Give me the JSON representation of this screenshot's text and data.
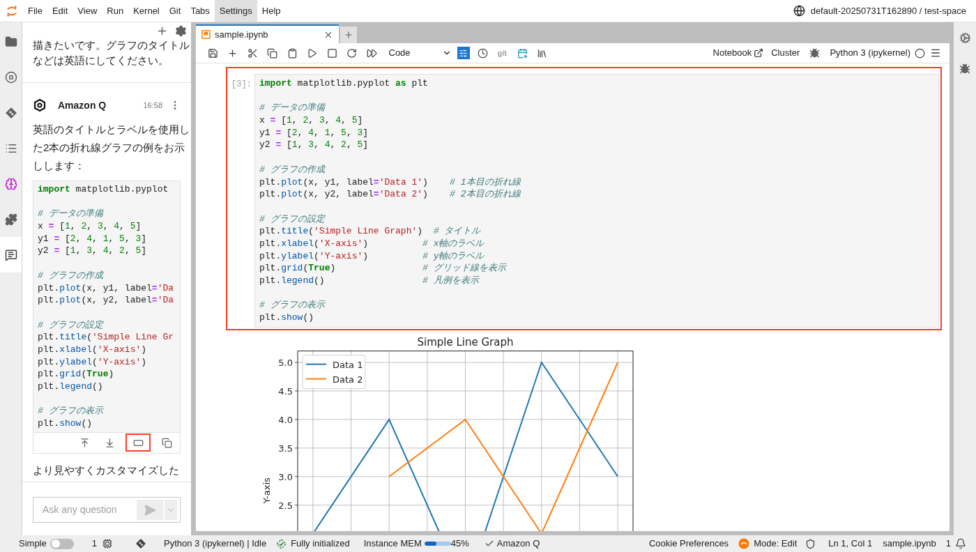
{
  "menu_bar": {
    "items": [
      {
        "label": "File",
        "selected": false
      },
      {
        "label": "Edit",
        "selected": false
      },
      {
        "label": "View",
        "selected": false
      },
      {
        "label": "Run",
        "selected": false
      },
      {
        "label": "Kernel",
        "selected": false
      },
      {
        "label": "Git",
        "selected": false
      },
      {
        "label": "Tabs",
        "selected": false
      },
      {
        "label": "Settings",
        "selected": true
      },
      {
        "label": "Help",
        "selected": false
      }
    ],
    "workspace": "default-20250731T162890 / test-space"
  },
  "activity_bar": {
    "items": [
      {
        "selected": false
      },
      {
        "selected": false
      },
      {
        "selected": false
      },
      {
        "selected": false
      },
      {
        "selected": false
      },
      {
        "selected": false
      },
      {
        "selected": true
      }
    ]
  },
  "chat": {
    "messages": [
      {
        "kind": "user",
        "text": "描きたいです。グラフのタイトルなどは英語にしてください。"
      },
      {
        "kind": "assistant",
        "sender": "Amazon Q",
        "time": "16:58",
        "text": "英語のタイトルとラベルを使用した2本の折れ線グラフの例をお示しします：",
        "code_lines": [
          {
            "kind": "code",
            "tokens": [
              {
                "kind": "kw",
                "text": "import"
              },
              {
                "kind": "plain",
                "text": " matplotlib.pyplot"
              }
            ]
          },
          {
            "kind": "blank"
          },
          {
            "kind": "code",
            "tokens": [
              {
                "kind": "cm",
                "text": "# データの準備"
              }
            ]
          },
          {
            "kind": "code",
            "tokens": [
              {
                "kind": "plain",
                "text": "x "
              },
              {
                "kind": "op",
                "text": "="
              },
              {
                "kind": "plain",
                "text": " ["
              },
              {
                "kind": "num",
                "text": "1"
              },
              {
                "kind": "plain",
                "text": ", "
              },
              {
                "kind": "num",
                "text": "2"
              },
              {
                "kind": "plain",
                "text": ", "
              },
              {
                "kind": "num",
                "text": "3"
              },
              {
                "kind": "plain",
                "text": ", "
              },
              {
                "kind": "num",
                "text": "4"
              },
              {
                "kind": "plain",
                "text": ", "
              },
              {
                "kind": "num",
                "text": "5"
              },
              {
                "kind": "plain",
                "text": "]"
              }
            ]
          },
          {
            "kind": "code",
            "tokens": [
              {
                "kind": "plain",
                "text": "y1 "
              },
              {
                "kind": "op",
                "text": "="
              },
              {
                "kind": "plain",
                "text": " ["
              },
              {
                "kind": "num",
                "text": "2"
              },
              {
                "kind": "plain",
                "text": ", "
              },
              {
                "kind": "num",
                "text": "4"
              },
              {
                "kind": "plain",
                "text": ", "
              },
              {
                "kind": "num",
                "text": "1"
              },
              {
                "kind": "plain",
                "text": ", "
              },
              {
                "kind": "num",
                "text": "5"
              },
              {
                "kind": "plain",
                "text": ", "
              },
              {
                "kind": "num",
                "text": "3"
              },
              {
                "kind": "plain",
                "text": "]"
              }
            ]
          },
          {
            "kind": "code",
            "tokens": [
              {
                "kind": "plain",
                "text": "y2 "
              },
              {
                "kind": "op",
                "text": "="
              },
              {
                "kind": "plain",
                "text": " ["
              },
              {
                "kind": "num",
                "text": "1"
              },
              {
                "kind": "plain",
                "text": ", "
              },
              {
                "kind": "num",
                "text": "3"
              },
              {
                "kind": "plain",
                "text": ", "
              },
              {
                "kind": "num",
                "text": "4"
              },
              {
                "kind": "plain",
                "text": ", "
              },
              {
                "kind": "num",
                "text": "2"
              },
              {
                "kind": "plain",
                "text": ", "
              },
              {
                "kind": "num",
                "text": "5"
              },
              {
                "kind": "plain",
                "text": "]"
              }
            ]
          },
          {
            "kind": "blank"
          },
          {
            "kind": "code",
            "tokens": [
              {
                "kind": "cm",
                "text": "# グラフの作成"
              }
            ]
          },
          {
            "kind": "code",
            "tokens": [
              {
                "kind": "plain",
                "text": "plt."
              },
              {
                "kind": "fn",
                "text": "plot"
              },
              {
                "kind": "plain",
                "text": "(x, y1, label"
              },
              {
                "kind": "op",
                "text": "="
              },
              {
                "kind": "str",
                "text": "'Da"
              }
            ]
          },
          {
            "kind": "code",
            "tokens": [
              {
                "kind": "plain",
                "text": "plt."
              },
              {
                "kind": "fn",
                "text": "plot"
              },
              {
                "kind": "plain",
                "text": "(x, y2, label"
              },
              {
                "kind": "op",
                "text": "="
              },
              {
                "kind": "str",
                "text": "'Da"
              }
            ]
          },
          {
            "kind": "blank"
          },
          {
            "kind": "code",
            "tokens": [
              {
                "kind": "cm",
                "text": "# グラフの設定"
              }
            ]
          },
          {
            "kind": "code",
            "tokens": [
              {
                "kind": "plain",
                "text": "plt."
              },
              {
                "kind": "fn",
                "text": "title"
              },
              {
                "kind": "plain",
                "text": "("
              },
              {
                "kind": "str",
                "text": "'Simple Line Gr"
              }
            ]
          },
          {
            "kind": "code",
            "tokens": [
              {
                "kind": "plain",
                "text": "plt."
              },
              {
                "kind": "fn",
                "text": "xlabel"
              },
              {
                "kind": "plain",
                "text": "("
              },
              {
                "kind": "str",
                "text": "'X-axis'"
              },
              {
                "kind": "plain",
                "text": ")"
              }
            ]
          },
          {
            "kind": "code",
            "tokens": [
              {
                "kind": "plain",
                "text": "plt."
              },
              {
                "kind": "fn",
                "text": "ylabel"
              },
              {
                "kind": "plain",
                "text": "("
              },
              {
                "kind": "str",
                "text": "'Y-axis'"
              },
              {
                "kind": "plain",
                "text": ")"
              }
            ]
          },
          {
            "kind": "code",
            "tokens": [
              {
                "kind": "plain",
                "text": "plt."
              },
              {
                "kind": "fn",
                "text": "grid"
              },
              {
                "kind": "plain",
                "text": "("
              },
              {
                "kind": "kw",
                "text": "True"
              },
              {
                "kind": "plain",
                "text": ")"
              }
            ]
          },
          {
            "kind": "code",
            "tokens": [
              {
                "kind": "plain",
                "text": "plt."
              },
              {
                "kind": "fn",
                "text": "legend"
              },
              {
                "kind": "plain",
                "text": "()"
              }
            ]
          },
          {
            "kind": "blank"
          },
          {
            "kind": "code",
            "tokens": [
              {
                "kind": "cm",
                "text": "# グラフの表示"
              }
            ]
          },
          {
            "kind": "code",
            "tokens": [
              {
                "kind": "plain",
                "text": "plt."
              },
              {
                "kind": "fn",
                "text": "show"
              },
              {
                "kind": "plain",
                "text": "()"
              }
            ]
          }
        ],
        "code_actions": [
          {
            "highlighted": false
          },
          {
            "highlighted": false
          },
          {
            "highlighted": true
          },
          {
            "highlighted": false
          }
        ],
        "continuation": "より見やすくカスタマイズした"
      }
    ],
    "input": {
      "placeholder": "Ask any question"
    }
  },
  "notebook": {
    "tabs": [
      {
        "label": "sample.ipynb",
        "selected": true
      }
    ],
    "toolbar": {
      "cell_type": "Code",
      "git_label": "git",
      "notebook_link": "Notebook",
      "cluster_link": "Cluster",
      "kernel": "Python 3 (ipykernel)"
    },
    "cell": {
      "prompt": "[3]:",
      "highlighted": true,
      "code_lines": [
        {
          "kind": "code",
          "tokens": [
            {
              "kind": "kw",
              "text": "import"
            },
            {
              "kind": "plain",
              "text": " matplotlib.pyplot "
            },
            {
              "kind": "kw",
              "text": "as"
            },
            {
              "kind": "plain",
              "text": " plt"
            }
          ]
        },
        {
          "kind": "blank"
        },
        {
          "kind": "code",
          "tokens": [
            {
              "kind": "cm",
              "text": "# データの準備"
            }
          ]
        },
        {
          "kind": "code",
          "tokens": [
            {
              "kind": "plain",
              "text": "x "
            },
            {
              "kind": "op",
              "text": "="
            },
            {
              "kind": "plain",
              "text": " ["
            },
            {
              "kind": "num",
              "text": "1"
            },
            {
              "kind": "plain",
              "text": ", "
            },
            {
              "kind": "num",
              "text": "2"
            },
            {
              "kind": "plain",
              "text": ", "
            },
            {
              "kind": "num",
              "text": "3"
            },
            {
              "kind": "plain",
              "text": ", "
            },
            {
              "kind": "num",
              "text": "4"
            },
            {
              "kind": "plain",
              "text": ", "
            },
            {
              "kind": "num",
              "text": "5"
            },
            {
              "kind": "plain",
              "text": "]"
            }
          ]
        },
        {
          "kind": "code",
          "tokens": [
            {
              "kind": "plain",
              "text": "y1 "
            },
            {
              "kind": "op",
              "text": "="
            },
            {
              "kind": "plain",
              "text": " ["
            },
            {
              "kind": "num",
              "text": "2"
            },
            {
              "kind": "plain",
              "text": ", "
            },
            {
              "kind": "num",
              "text": "4"
            },
            {
              "kind": "plain",
              "text": ", "
            },
            {
              "kind": "num",
              "text": "1"
            },
            {
              "kind": "plain",
              "text": ", "
            },
            {
              "kind": "num",
              "text": "5"
            },
            {
              "kind": "plain",
              "text": ", "
            },
            {
              "kind": "num",
              "text": "3"
            },
            {
              "kind": "plain",
              "text": "]"
            }
          ]
        },
        {
          "kind": "code",
          "tokens": [
            {
              "kind": "plain",
              "text": "y2 "
            },
            {
              "kind": "op",
              "text": "="
            },
            {
              "kind": "plain",
              "text": " ["
            },
            {
              "kind": "num",
              "text": "1"
            },
            {
              "kind": "plain",
              "text": ", "
            },
            {
              "kind": "num",
              "text": "3"
            },
            {
              "kind": "plain",
              "text": ", "
            },
            {
              "kind": "num",
              "text": "4"
            },
            {
              "kind": "plain",
              "text": ", "
            },
            {
              "kind": "num",
              "text": "2"
            },
            {
              "kind": "plain",
              "text": ", "
            },
            {
              "kind": "num",
              "text": "5"
            },
            {
              "kind": "plain",
              "text": "]"
            }
          ]
        },
        {
          "kind": "blank"
        },
        {
          "kind": "code",
          "tokens": [
            {
              "kind": "cm",
              "text": "# グラフの作成"
            }
          ]
        },
        {
          "kind": "code",
          "tokens": [
            {
              "kind": "plain",
              "text": "plt."
            },
            {
              "kind": "fn",
              "text": "plot"
            },
            {
              "kind": "plain",
              "text": "(x, y1, label"
            },
            {
              "kind": "op",
              "text": "="
            },
            {
              "kind": "str",
              "text": "'Data 1'"
            },
            {
              "kind": "plain",
              "text": ")    "
            },
            {
              "kind": "cm",
              "text": "# 1本目の折れ線"
            }
          ]
        },
        {
          "kind": "code",
          "tokens": [
            {
              "kind": "plain",
              "text": "plt."
            },
            {
              "kind": "fn",
              "text": "plot"
            },
            {
              "kind": "plain",
              "text": "(x, y2, label"
            },
            {
              "kind": "op",
              "text": "="
            },
            {
              "kind": "str",
              "text": "'Data 2'"
            },
            {
              "kind": "plain",
              "text": ")    "
            },
            {
              "kind": "cm",
              "text": "# 2本目の折れ線"
            }
          ]
        },
        {
          "kind": "blank"
        },
        {
          "kind": "code",
          "tokens": [
            {
              "kind": "cm",
              "text": "# グラフの設定"
            }
          ]
        },
        {
          "kind": "code",
          "tokens": [
            {
              "kind": "plain",
              "text": "plt."
            },
            {
              "kind": "fn",
              "text": "title"
            },
            {
              "kind": "plain",
              "text": "("
            },
            {
              "kind": "str",
              "text": "'Simple Line Graph'"
            },
            {
              "kind": "plain",
              "text": ")  "
            },
            {
              "kind": "cm",
              "text": "# タイトル"
            }
          ]
        },
        {
          "kind": "code",
          "tokens": [
            {
              "kind": "plain",
              "text": "plt."
            },
            {
              "kind": "fn",
              "text": "xlabel"
            },
            {
              "kind": "plain",
              "text": "("
            },
            {
              "kind": "str",
              "text": "'X-axis'"
            },
            {
              "kind": "plain",
              "text": ")          "
            },
            {
              "kind": "cm",
              "text": "# x軸のラベル"
            }
          ]
        },
        {
          "kind": "code",
          "tokens": [
            {
              "kind": "plain",
              "text": "plt."
            },
            {
              "kind": "fn",
              "text": "ylabel"
            },
            {
              "kind": "plain",
              "text": "("
            },
            {
              "kind": "str",
              "text": "'Y-axis'"
            },
            {
              "kind": "plain",
              "text": ")          "
            },
            {
              "kind": "cm",
              "text": "# y軸のラベル"
            }
          ]
        },
        {
          "kind": "code",
          "tokens": [
            {
              "kind": "plain",
              "text": "plt."
            },
            {
              "kind": "fn",
              "text": "grid"
            },
            {
              "kind": "plain",
              "text": "("
            },
            {
              "kind": "kw",
              "text": "True"
            },
            {
              "kind": "plain",
              "text": ")                "
            },
            {
              "kind": "cm",
              "text": "# グリッド線を表示"
            }
          ]
        },
        {
          "kind": "code",
          "tokens": [
            {
              "kind": "plain",
              "text": "plt."
            },
            {
              "kind": "fn",
              "text": "legend"
            },
            {
              "kind": "plain",
              "text": "()                  "
            },
            {
              "kind": "cm",
              "text": "# 凡例を表示"
            }
          ]
        },
        {
          "kind": "blank"
        },
        {
          "kind": "code",
          "tokens": [
            {
              "kind": "cm",
              "text": "# グラフの表示"
            }
          ]
        },
        {
          "kind": "code",
          "tokens": [
            {
              "kind": "plain",
              "text": "plt."
            },
            {
              "kind": "fn",
              "text": "show"
            },
            {
              "kind": "plain",
              "text": "()"
            }
          ]
        }
      ],
      "output": {
        "chart_data": {
          "type": "line",
          "title": "Simple Line Graph",
          "ylabel": "Y-axis",
          "categories": [
            null,
            null,
            null,
            null,
            null
          ],
          "series": [
            {
              "name": "Data 1",
              "color": "#1f77b4",
              "values": [
                2,
                4,
                1,
                5,
                3
              ]
            },
            {
              "name": "Data 2",
              "color": "#ff7f0e",
              "values": [
                null,
                3,
                4,
                2,
                5
              ]
            }
          ],
          "grid": true,
          "legend": true,
          "ylim": [
            0.8,
            5.2
          ],
          "yticks": [
            {
              "value": 2.5,
              "label": "2.5"
            },
            {
              "value": 3,
              "label": "3.0"
            },
            {
              "value": 3.5,
              "label": "3.5"
            },
            {
              "value": 4,
              "label": "4.0"
            },
            {
              "value": 4.5,
              "label": "4.5"
            },
            {
              "value": 5,
              "label": "5.0"
            }
          ]
        }
      }
    }
  },
  "status_bar": {
    "mode_label": "Simple",
    "simple_mode": false,
    "terminals": "1",
    "kernel_status": "Python 3 (ipykernel) | Idle",
    "init_status": "Fully initialized",
    "memory": {
      "label": "Instance MEM",
      "level": 0.45,
      "reading": "45%"
    },
    "assistant": "Amazon Q",
    "cookie": "Cookie Preferences",
    "mode": "Mode: Edit",
    "cursor": "Ln 1, Col 1",
    "file": "sample.ipynb",
    "notifications": "1"
  }
}
